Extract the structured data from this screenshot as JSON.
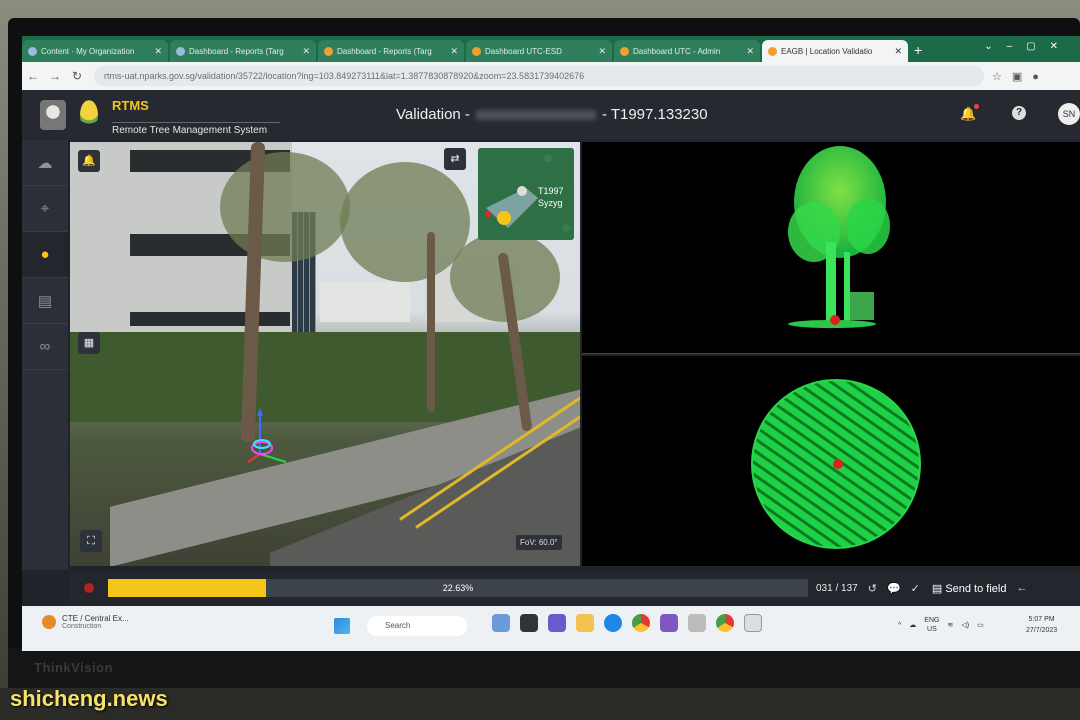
{
  "browser": {
    "tabs": [
      {
        "label": "Content · My Organization",
        "active": false
      },
      {
        "label": "Dashboard - Reports (Targ",
        "active": false
      },
      {
        "label": "Dashboard - Reports (Targ",
        "active": false
      },
      {
        "label": "Dashboard UTC-ESD",
        "active": false
      },
      {
        "label": "Dashboard UTC - Admin",
        "active": false
      },
      {
        "label": "EAGB | Location Validatio",
        "active": true
      }
    ],
    "url": "rtms-uat.nparks.gov.sg/validation/35722/location?lng=103.849273111&lat=1.3877830878920&zoom=23.5831739402676"
  },
  "app": {
    "name": "RTMS",
    "subtitle": "Remote Tree Management System",
    "title_prefix": "Validation -",
    "title_suffix": "- T1997.133230",
    "avatar": "SN"
  },
  "street_view": {
    "minimap_label_1": "T1997",
    "minimap_label_2": "Syzyg",
    "fov": "FoV: 60.0°"
  },
  "progress": {
    "percent_label": "22.63%",
    "fraction": 0.2263,
    "counter": "031 / 137",
    "send_label": "Send to field"
  },
  "taskbar": {
    "weather_line1": "CTE / Central Ex...",
    "weather_line2": "Construction",
    "search_placeholder": "Search",
    "lang1": "ENG",
    "lang2": "US",
    "time": "5:07 PM",
    "date": "27/7/2023"
  },
  "colors": {
    "accent": "#f5c518",
    "point_cloud": "#22e04a",
    "marker": "#e02020"
  },
  "icons": [
    "bell-icon",
    "help-icon",
    "turtle-icon",
    "map-icon",
    "location-pin-icon",
    "document-icon",
    "link-icon",
    "settings-sliders-icon",
    "fullscreen-icon",
    "undo-icon",
    "comment-icon",
    "check-icon",
    "send-icon",
    "back-arrow-icon"
  ],
  "watermark": "shicheng.news"
}
